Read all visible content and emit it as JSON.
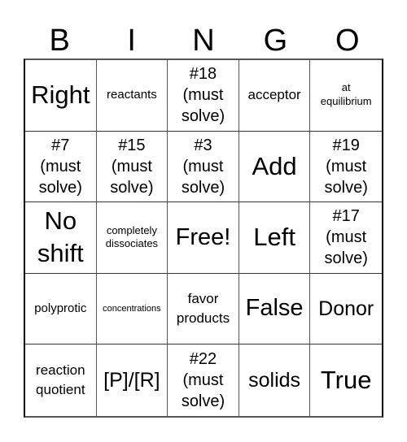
{
  "card": {
    "header": [
      "B",
      "I",
      "N",
      "G",
      "O"
    ],
    "rows": [
      [
        {
          "text": "Right",
          "size": "xl"
        },
        {
          "text": "reactants",
          "size": "s"
        },
        {
          "text": "#18 (must solve)",
          "lines": [
            "#18",
            "(must",
            "solve)"
          ],
          "size": "must"
        },
        {
          "text": "acceptor",
          "size": "m"
        },
        {
          "text": "at equilibrium",
          "lines": [
            "at",
            "equilibrium"
          ],
          "size": "xs"
        }
      ],
      [
        {
          "text": "#7 (must solve)",
          "lines": [
            "#7",
            "(must",
            "solve)"
          ],
          "size": "must"
        },
        {
          "text": "#15 (must solve)",
          "lines": [
            "#15",
            "(must",
            "solve)"
          ],
          "size": "must"
        },
        {
          "text": "#3 (must solve)",
          "lines": [
            "#3",
            "(must",
            "solve)"
          ],
          "size": "must"
        },
        {
          "text": "Add",
          "size": "xl"
        },
        {
          "text": "#19 (must solve)",
          "lines": [
            "#19",
            "(must",
            "solve)"
          ],
          "size": "must"
        }
      ],
      [
        {
          "text": "No shift",
          "lines": [
            "No",
            "shift"
          ],
          "size": "xl"
        },
        {
          "text": "completely dissociates",
          "lines": [
            "completely",
            "dissociates"
          ],
          "size": "xs"
        },
        {
          "text": "Free!",
          "size": "xl-free",
          "free_space": true
        },
        {
          "text": "Left",
          "size": "xl"
        },
        {
          "text": "#17 (must solve)",
          "lines": [
            "#17",
            "(must",
            "solve)"
          ],
          "size": "must"
        }
      ],
      [
        {
          "text": "polyprotic",
          "size": "s"
        },
        {
          "text": "concentrations",
          "size": "xxs"
        },
        {
          "text": "favor products",
          "lines": [
            "favor",
            "products"
          ],
          "size": "m"
        },
        {
          "text": "False",
          "size": "xl-false"
        },
        {
          "text": "Donor",
          "size": "l-donor"
        }
      ],
      [
        {
          "text": "reaction quotient",
          "lines": [
            "reaction",
            "quotient"
          ],
          "size": "m"
        },
        {
          "text": "[P]/[R]",
          "size": "l-pr"
        },
        {
          "text": "#22 (must solve)",
          "lines": [
            "#22",
            "(must",
            "solve)"
          ],
          "size": "must"
        },
        {
          "text": "solids",
          "size": "l-solids"
        },
        {
          "text": "True",
          "size": "xl"
        }
      ]
    ]
  }
}
